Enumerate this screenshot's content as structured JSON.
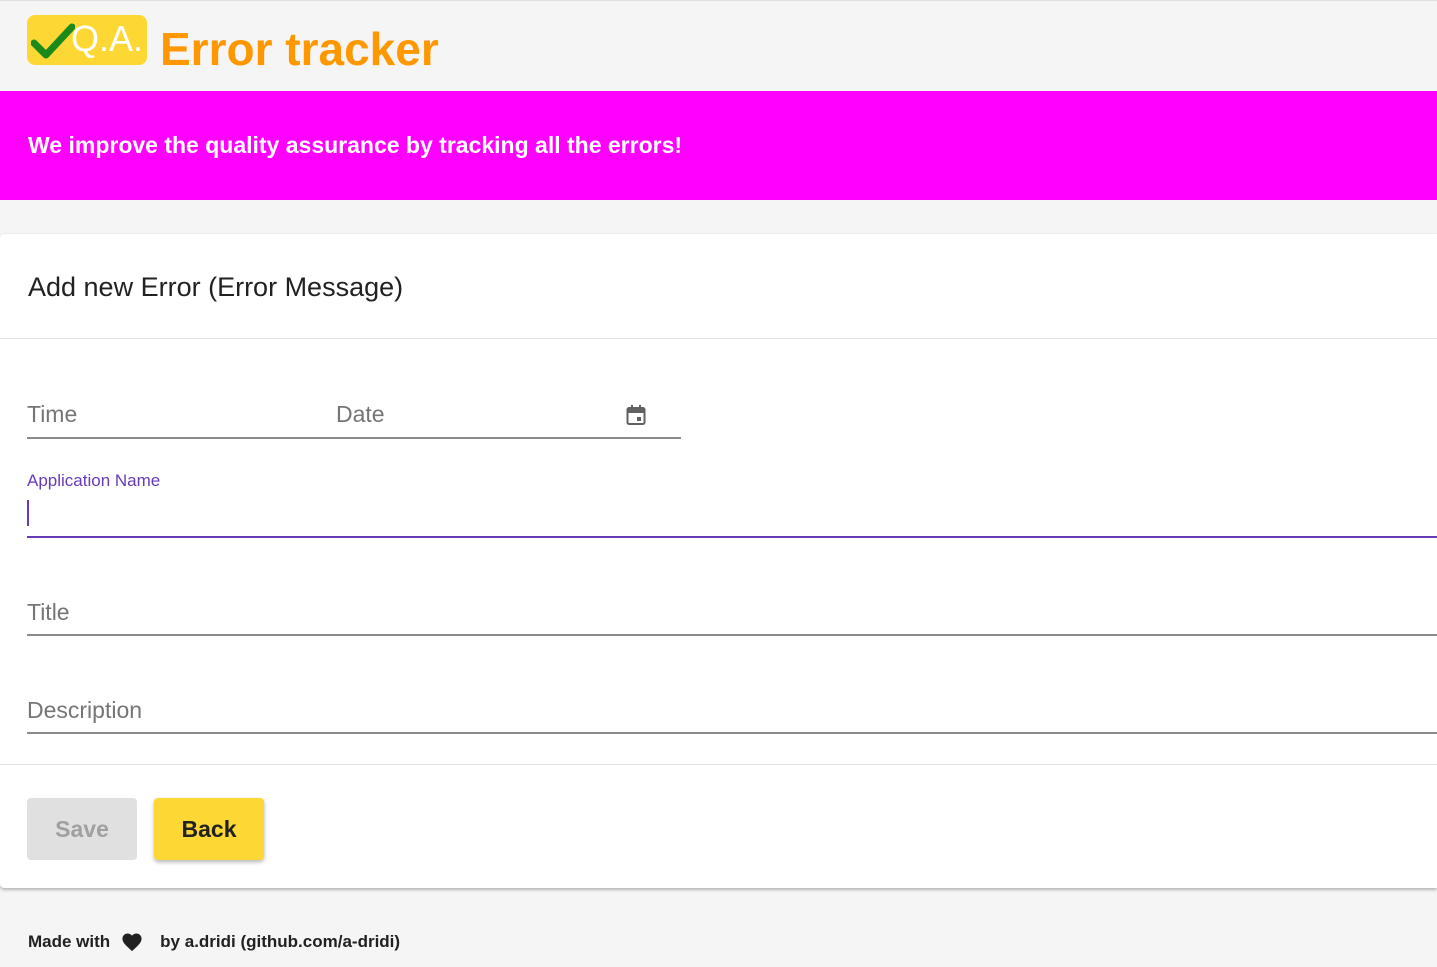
{
  "header": {
    "logo_text": "Q.A.",
    "title": "Error tracker"
  },
  "banner": {
    "text": "We improve the quality assurance by tracking all the errors!"
  },
  "form": {
    "title": "Add new Error (Error Message)",
    "time_label": "Time",
    "date_label": "Date",
    "app_name_label": "Application Name",
    "app_name_value": "",
    "title_label": "Title",
    "description_label": "Description"
  },
  "actions": {
    "save_label": "Save",
    "back_label": "Back"
  },
  "footer": {
    "made_with": "Made with",
    "credit": "by a.dridi (github.com/a-dridi)"
  },
  "colors": {
    "accent": "#673ab7",
    "banner": "#ff00ff",
    "title": "#ff9800",
    "button": "#fdd835"
  },
  "icons": {
    "logo_check": "check-icon",
    "date_picker": "calendar-icon",
    "footer_heart": "heart-icon"
  }
}
